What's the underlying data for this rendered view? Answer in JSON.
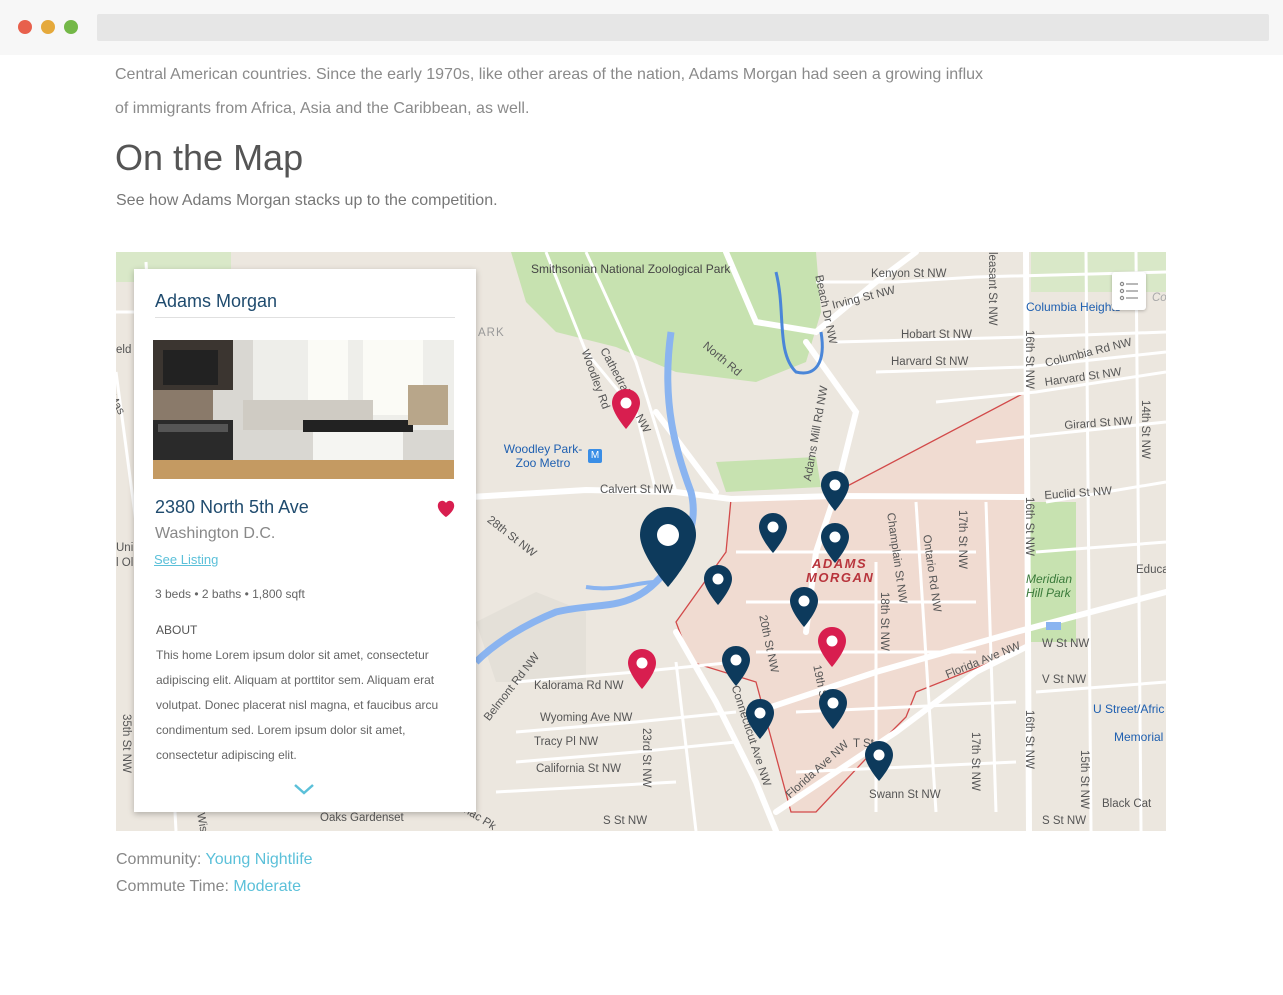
{
  "browser": {
    "url": ""
  },
  "article": {
    "paragraph": "Central American countries. Since the early 1970s, like other areas of the nation, Adams Morgan had seen a growing influx of immigrants from Africa, Asia and the Caribbean, as well.",
    "heading": "On the Map",
    "subheading": "See how Adams Morgan stacks up to the competition."
  },
  "map": {
    "labels": {
      "zoo": "Smithsonian National Zoological Park",
      "woodley": "Woodley Park-Zoo Metro",
      "neighborhood_1": "ADAMS",
      "neighborhood_2": "MORGAN",
      "meridian": "Meridian Hill Park",
      "columbia_heights": "Columbia Heights",
      "u_street": "U Street/Afric",
      "memorial": "Memorial",
      "black_cat": "Black Cat",
      "oaks": "Oaks Gardenset",
      "ark": "ARK",
      "educa": "Educa",
      "kenyon": "Kenyon St NW",
      "irving": "Irving St NW",
      "hobart": "Hobart St NW",
      "harvard": "Harvard St NW",
      "harvard_e": "Harvard St NW",
      "columbia_rd": "Columbia Rd NW",
      "girard": "Girard St NW",
      "euclid": "Euclid St NW",
      "calvert": "Calvert St NW",
      "st28": "28th St NW",
      "cathedral": "Cathedral Ave NW",
      "woodley_rd": "Woodley Rd",
      "north_rd": "North Rd",
      "beach": "Beach Dr NW",
      "adams_mill": "Adams Mill Rd NW",
      "champlain": "Champlain St NW",
      "ontario": "Ontario Rd NW",
      "st17": "17th St NW",
      "st16a": "16th St NW",
      "st16b": "16th St NW",
      "st16c": "16th St NW",
      "st14": "14th St NW",
      "st18": "18th St NW",
      "st20": "20th St NW",
      "st19": "19th St",
      "st23": "23rd St NW",
      "st17b": "17th St NW",
      "st15": "15th St NW",
      "florida1": "Florida Ave NW",
      "florida2": "Florida Ave NW",
      "connecticut": "Connecticut Ave NW",
      "w_st": "W St NW",
      "v_st": "V St NW",
      "t_st": "T St",
      "swann": "Swann St NW",
      "s_st": "S St NW",
      "s_st2": "S St NW",
      "kalorama": "Kalorama Rd NW",
      "belmont": "Belmont Rd NW",
      "wyoming": "Wyoming Ave NW",
      "tracy": "Tracy Pl NW",
      "california": "California St NW",
      "pleasant": "leasant St NW",
      "nac": "nac Pk",
      "uni": "Uni",
      "l_ol": "l Ol",
      "eld": "eld S",
      "mas": "Mas",
      "st35": "35th St NW",
      "wis": "Wisc",
      "co": "Co"
    }
  },
  "card": {
    "title": "Adams Morgan",
    "address": "2380 North 5th Ave",
    "city": "Washington D.C.",
    "link": "See Listing",
    "specs": "3 beds • 2 baths • 1,800 sqft",
    "about_heading": "ABOUT",
    "about_text": "This home Lorem ipsum dolor sit amet, consectetur adipiscing elit. Aliquam at porttitor sem. Aliquam erat volutpat. Donec placerat nisl magna, et faucibus arcu condimentum sed. Lorem ipsum dolor sit amet, consectetur adipiscing elit.",
    "favorited": true
  },
  "meta": {
    "community_label": "Community:",
    "community_value": "Young Nightlife",
    "commute_label": "Commute Time:",
    "commute_value": "Moderate"
  },
  "colors": {
    "accent": "#5bc0d9",
    "pin_navy": "#0d3a5c",
    "pin_red": "#d81e4f",
    "title_navy": "#1f4b6e"
  },
  "icons": [
    "list-icon",
    "heart-icon",
    "chevron-down-icon",
    "map-pin-icon",
    "metro-icon"
  ]
}
